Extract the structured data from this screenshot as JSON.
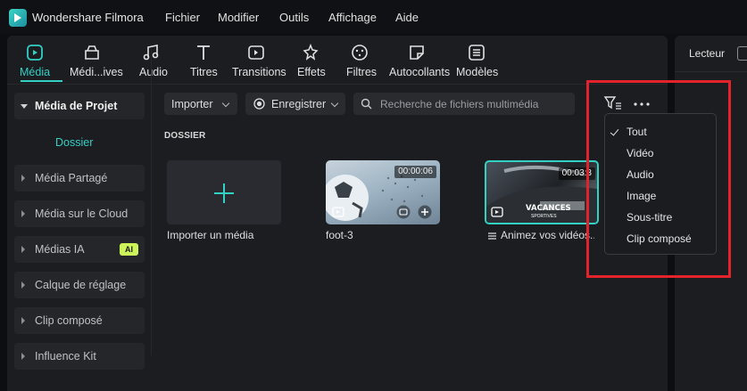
{
  "app": {
    "title": "Wondershare Filmora"
  },
  "menu": [
    "Fichier",
    "Modifier",
    "Outils",
    "Affichage",
    "Aide"
  ],
  "tabs": [
    {
      "label": "Média",
      "icon": "media-icon",
      "active": true
    },
    {
      "label": "Médi...ives",
      "icon": "stock-media-icon"
    },
    {
      "label": "Audio",
      "icon": "music-note-icon"
    },
    {
      "label": "Titres",
      "icon": "text-icon"
    },
    {
      "label": "Transitions",
      "icon": "transition-icon"
    },
    {
      "label": "Effets",
      "icon": "effects-icon"
    },
    {
      "label": "Filtres",
      "icon": "filters-icon"
    },
    {
      "label": "Autocollants",
      "icon": "sticker-icon"
    },
    {
      "label": "Modèles",
      "icon": "templates-icon"
    }
  ],
  "right_panel": {
    "title": "Lecteur"
  },
  "sidebar": {
    "items": [
      {
        "label": "Média de Projet",
        "open": true
      },
      {
        "label": "Dossier",
        "sub": true
      },
      {
        "label": "Média Partagé"
      },
      {
        "label": "Média sur le Cloud"
      },
      {
        "label": "Médias IA",
        "badge": "AI"
      },
      {
        "label": "Calque de réglage"
      },
      {
        "label": "Clip composé"
      },
      {
        "label": "Influence Kit"
      }
    ]
  },
  "content": {
    "import_button": "Importer",
    "record_button": "Enregistrer",
    "search_placeholder": "Recherche de fichiers multimédia",
    "section_title": "DOSSIER",
    "cards": [
      {
        "label": "Importer un média"
      },
      {
        "label": "foot-3",
        "duration": "00:00:06"
      },
      {
        "label": "Animez vos vidéos...",
        "duration": "00:03:3",
        "overlay_text": "VACANCES",
        "overlay_sub": "SPORTIVES"
      }
    ]
  },
  "filter_menu": {
    "items": [
      "Tout",
      "Vidéo",
      "Audio",
      "Image",
      "Sous-titre",
      "Clip composé"
    ],
    "selected": "Tout"
  },
  "colors": {
    "accent": "#33d0c4",
    "highlight": "#e3232b",
    "ai_badge": "#cdf35a"
  }
}
